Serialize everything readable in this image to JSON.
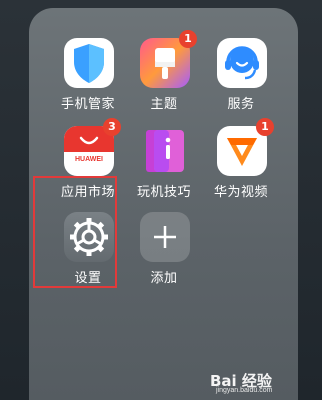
{
  "folder": {
    "apps": [
      {
        "label": "手机管家",
        "icon": "shield-icon",
        "badge": null
      },
      {
        "label": "主题",
        "icon": "paintbrush-icon",
        "badge": "1"
      },
      {
        "label": "服务",
        "icon": "headset-icon",
        "badge": null
      },
      {
        "label": "应用市场",
        "icon": "huawei-bag-icon",
        "badge": "3",
        "icon_text": "HUAWEI"
      },
      {
        "label": "玩机技巧",
        "icon": "tips-book-icon",
        "badge": null
      },
      {
        "label": "华为视频",
        "icon": "play-icon",
        "badge": "1"
      },
      {
        "label": "设置",
        "icon": "gear-icon",
        "badge": null
      },
      {
        "label": "添加",
        "icon": "plus-icon",
        "badge": null
      }
    ]
  },
  "watermark": {
    "main": "Bai 经验",
    "sub": "jingyan.baidu.com"
  },
  "colors": {
    "badge": "#e8412e",
    "highlight": "#e23a3a"
  }
}
